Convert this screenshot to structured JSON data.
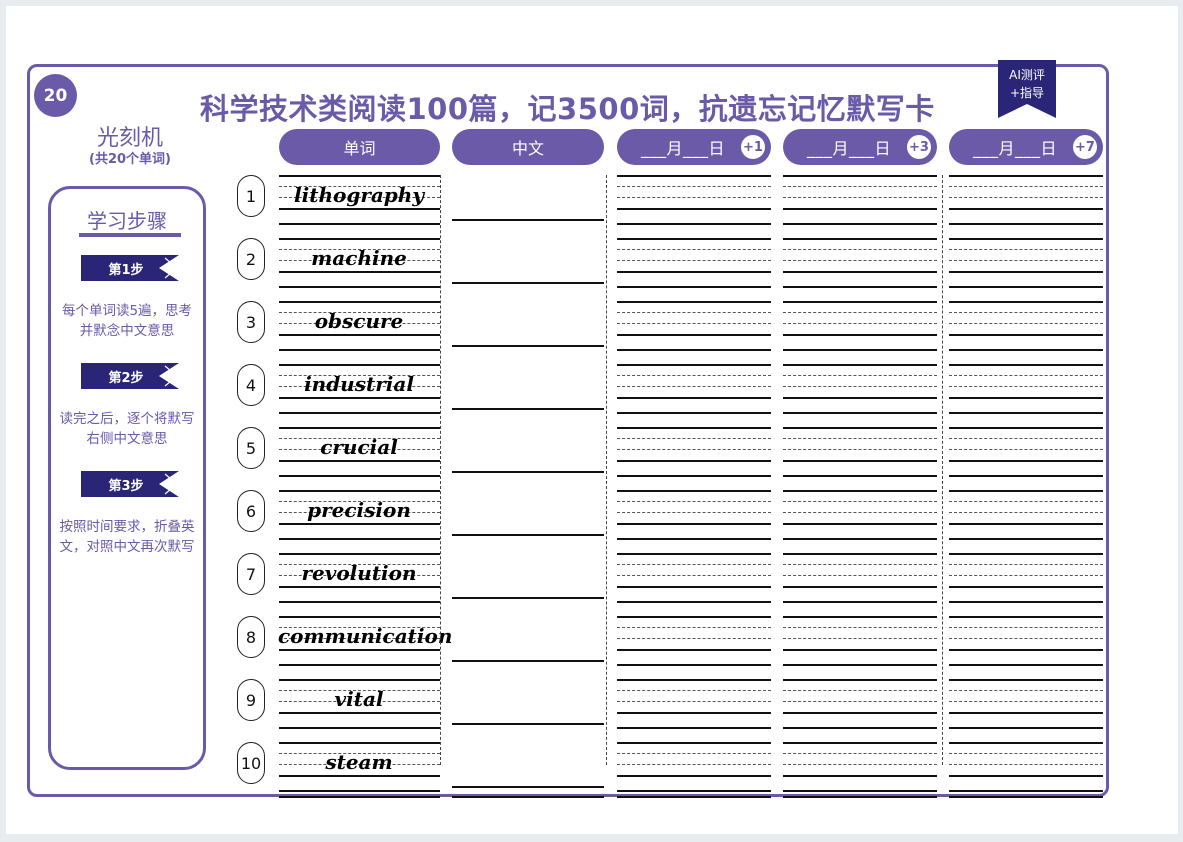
{
  "card": {
    "number": "20",
    "title": "科学技术类阅读100篇，记3500词，抗遗忘记忆默写卡",
    "ai_tag": {
      "line1": "AI测评",
      "line2": "+指导"
    },
    "topic": "光刻机",
    "topic_count": "(共20个单词)"
  },
  "steps": {
    "title": "学习步骤",
    "items": [
      {
        "label": "第1步",
        "desc": "每个单词读5遍，思考并默念中文意思"
      },
      {
        "label": "第2步",
        "desc": "读完之后，逐个将默写右侧中文意思"
      },
      {
        "label": "第3步",
        "desc": "按照时间要求，折叠英文，对照中文再次默写"
      }
    ]
  },
  "headers": {
    "word": "单词",
    "chinese": "中文",
    "review": [
      {
        "date": "___月___日",
        "plus": "+1"
      },
      {
        "date": "___月___日",
        "plus": "+3"
      },
      {
        "date": "___月___日",
        "plus": "+7"
      }
    ]
  },
  "words": [
    {
      "n": "1",
      "word": "lithography"
    },
    {
      "n": "2",
      "word": "machine"
    },
    {
      "n": "3",
      "word": "obscure"
    },
    {
      "n": "4",
      "word": "industrial"
    },
    {
      "n": "5",
      "word": "crucial"
    },
    {
      "n": "6",
      "word": "precision"
    },
    {
      "n": "7",
      "word": "revolution"
    },
    {
      "n": "8",
      "word": "communication"
    },
    {
      "n": "9",
      "word": "vital"
    },
    {
      "n": "10",
      "word": "steam"
    }
  ],
  "colors": {
    "accent": "#6a5aa8",
    "flag": "#2b2577"
  }
}
